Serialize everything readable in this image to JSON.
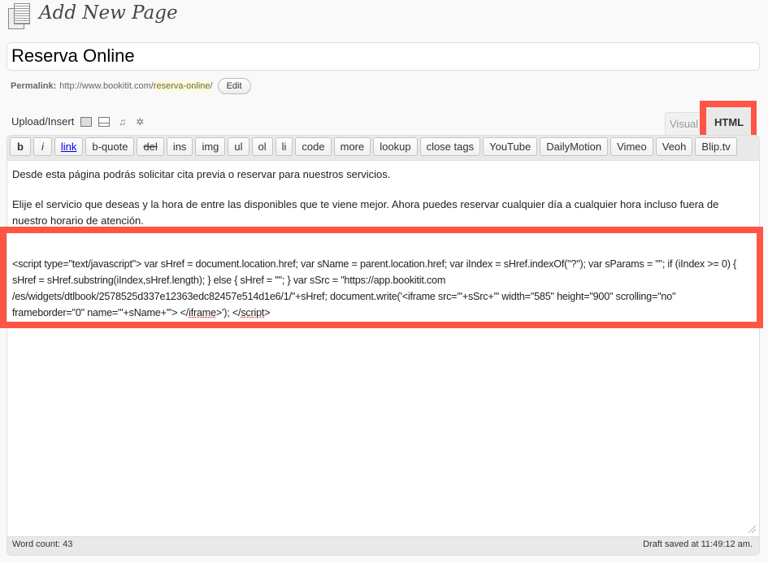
{
  "header": {
    "title": "Add New Page",
    "icon": "pages-icon"
  },
  "post": {
    "title": "Reserva Online"
  },
  "permalink": {
    "label": "Permalink:",
    "base": "http://www.bookitit.com/",
    "slug": "reserva-online",
    "trail": "/",
    "edit_label": "Edit"
  },
  "upload": {
    "label": "Upload/Insert",
    "icons": [
      "add-image-icon",
      "add-video-icon",
      "add-audio-icon",
      "add-media-icon"
    ]
  },
  "tabs": {
    "visual": "Visual",
    "html": "HTML",
    "active": "HTML"
  },
  "toolbar": [
    "b",
    "i",
    "link",
    "b-quote",
    "del",
    "ins",
    "img",
    "ul",
    "ol",
    "li",
    "code",
    "more",
    "lookup",
    "close tags",
    "YouTube",
    "DailyMotion",
    "Vimeo",
    "Veoh",
    "Blip.tv"
  ],
  "content": {
    "p1": "Desde esta página podrás solicitar cita previa o reservar para nuestros servicios.",
    "p2": "Elije el servicio que deseas y la hora de entre las disponibles que te viene mejor. Ahora puedes reservar cualquier día a cualquier hora incluso fuera de nuestro horario de atención.",
    "code_a": "<script type=\"text/javascript\"> var sHref = document.location.href; var sName = parent.location.href; var iIndex = sHref.indexOf(\"?\"); var sParams = \"\"; if (iIndex >= 0) { sHref = sHref.substring(iIndex,sHref.length); } else { sHref = \"\"; } var sSrc = \"https://app.bookitit.com /es/widgets/dtlbook/2578525d337e12363edc82457e514d1e6/1/\"+sHref; document.write('<iframe src=\"'+sSrc+'\" width=\"585\" height=\"900\" scrolling=\"no\" frameborder=\"0\" name=\"'+sName+'\"> </",
    "code_iframe": "iframe",
    "code_b": ">'); </",
    "code_script": "script",
    "code_c": ">"
  },
  "footer": {
    "word_count": "Word count: 43",
    "draft_status": "Draft saved at 11:49:12 am."
  },
  "colors": {
    "highlight": "#ff5545",
    "slug_bg": "#fffbcc"
  }
}
